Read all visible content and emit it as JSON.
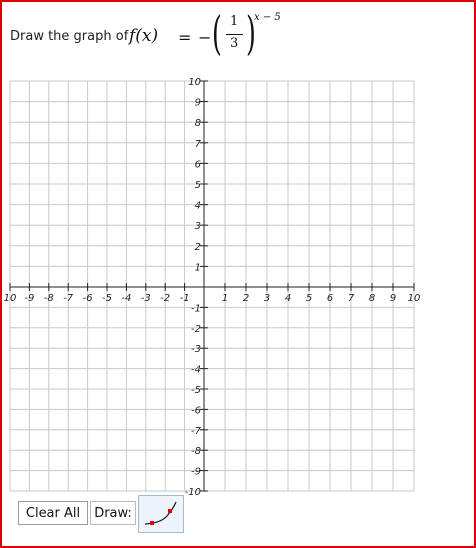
{
  "question": {
    "prompt": "Draw the graph of",
    "function_name": "f(x)",
    "equals": "=",
    "sign": "−",
    "base_numerator": "1",
    "base_denominator": "3",
    "exponent": "x − 5"
  },
  "graph": {
    "x_range": [
      -10,
      10
    ],
    "y_range": [
      -10,
      10
    ],
    "x_tick_labels": [
      "10",
      "-9",
      "-8",
      "-7",
      "-6",
      "-5",
      "-4",
      "-3",
      "-2",
      "-1",
      "1",
      "2",
      "3",
      "4",
      "5",
      "6",
      "7",
      "8",
      "9",
      "10"
    ],
    "x_tick_values": [
      -10,
      -9,
      -8,
      -7,
      -6,
      -5,
      -4,
      -3,
      -2,
      -1,
      1,
      2,
      3,
      4,
      5,
      6,
      7,
      8,
      9,
      10
    ],
    "y_tick_labels_pos": [
      "10",
      "9",
      "8",
      "7",
      "6",
      "5",
      "4",
      "3",
      "2",
      "1"
    ],
    "y_tick_values_pos": [
      10,
      9,
      8,
      7,
      6,
      5,
      4,
      3,
      2,
      1
    ],
    "y_tick_labels_neg": [
      "-1",
      "-2",
      "-3",
      "-4",
      "-5",
      "-6",
      "-7",
      "-8",
      "-9",
      "-10"
    ],
    "y_tick_values_neg": [
      -1,
      -2,
      -3,
      -4,
      -5,
      -6,
      -7,
      -8,
      -9,
      -10
    ],
    "grid": true,
    "colors": {
      "grid": "#c8c8c8",
      "axis": "#222222",
      "border": "#e00000"
    }
  },
  "controls": {
    "clear_label": "Clear All",
    "draw_label": "Draw:",
    "draw_tool_icon": "exponential-curve-icon"
  }
}
